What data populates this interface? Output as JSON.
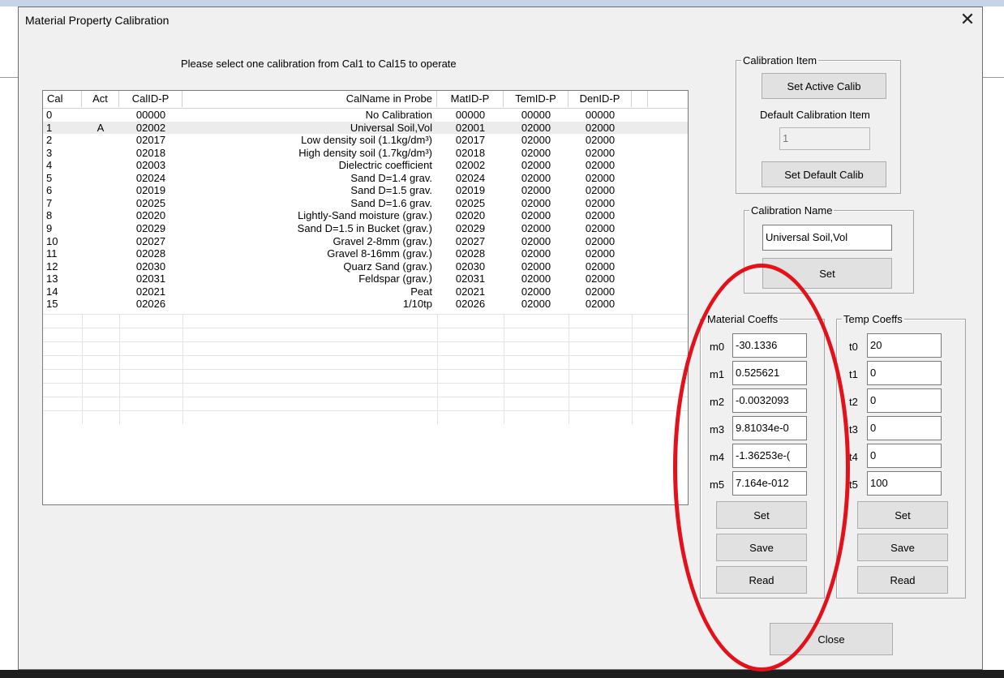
{
  "dialog": {
    "title": "Material Property Calibration",
    "close_glyph": "✕",
    "instruction": "Please select one calibration from Cal1 to Cal15 to operate"
  },
  "table": {
    "columns": [
      "Cal",
      "Act",
      "CalID-P",
      "CalName in Probe",
      "MatID-P",
      "TemID-P",
      "DenID-P"
    ],
    "rows": [
      {
        "cal": "0",
        "act": "",
        "calid": "00000",
        "name": "No Calibration",
        "matid": "00000",
        "temid": "00000",
        "denid": "00000"
      },
      {
        "cal": "1",
        "act": "A",
        "calid": "02002",
        "name": "Universal Soil,Vol",
        "matid": "02001",
        "temid": "02000",
        "denid": "02000"
      },
      {
        "cal": "2",
        "act": "",
        "calid": "02017",
        "name": "Low density soil (1.1kg/dm³)",
        "matid": "02017",
        "temid": "02000",
        "denid": "02000"
      },
      {
        "cal": "3",
        "act": "",
        "calid": "02018",
        "name": "High density soil (1.7kg/dm³)",
        "matid": "02018",
        "temid": "02000",
        "denid": "02000"
      },
      {
        "cal": "4",
        "act": "",
        "calid": "02003",
        "name": "Dielectric coefficient",
        "matid": "02002",
        "temid": "02000",
        "denid": "02000"
      },
      {
        "cal": "5",
        "act": "",
        "calid": "02024",
        "name": "Sand D=1.4 grav.",
        "matid": "02024",
        "temid": "02000",
        "denid": "02000"
      },
      {
        "cal": "6",
        "act": "",
        "calid": "02019",
        "name": "Sand D=1.5 grav.",
        "matid": "02019",
        "temid": "02000",
        "denid": "02000"
      },
      {
        "cal": "7",
        "act": "",
        "calid": "02025",
        "name": "Sand D=1.6 grav.",
        "matid": "02025",
        "temid": "02000",
        "denid": "02000"
      },
      {
        "cal": "8",
        "act": "",
        "calid": "02020",
        "name": "Lightly-Sand moisture (grav.)",
        "matid": "02020",
        "temid": "02000",
        "denid": "02000"
      },
      {
        "cal": "9",
        "act": "",
        "calid": "02029",
        "name": "Sand D=1.5 in Bucket (grav.)",
        "matid": "02029",
        "temid": "02000",
        "denid": "02000"
      },
      {
        "cal": "10",
        "act": "",
        "calid": "02027",
        "name": "Gravel 2-8mm (grav.)",
        "matid": "02027",
        "temid": "02000",
        "denid": "02000"
      },
      {
        "cal": "11",
        "act": "",
        "calid": "02028",
        "name": "Gravel 8-16mm (grav.)",
        "matid": "02028",
        "temid": "02000",
        "denid": "02000"
      },
      {
        "cal": "12",
        "act": "",
        "calid": "02030",
        "name": "Quarz Sand (grav.)",
        "matid": "02030",
        "temid": "02000",
        "denid": "02000"
      },
      {
        "cal": "13",
        "act": "",
        "calid": "02031",
        "name": "Feldspar (grav.)",
        "matid": "02031",
        "temid": "02000",
        "denid": "02000"
      },
      {
        "cal": "14",
        "act": "",
        "calid": "02021",
        "name": "Peat",
        "matid": "02021",
        "temid": "02000",
        "denid": "02000"
      },
      {
        "cal": "15",
        "act": "",
        "calid": "02026",
        "name": "1/10tp",
        "matid": "02026",
        "temid": "02000",
        "denid": "02000"
      }
    ]
  },
  "calibration_item": {
    "legend": "Calibration Item",
    "set_active_label": "Set Active Calib",
    "default_label": "Default Calibration Item",
    "default_value": "1",
    "set_default_label": "Set Default Calib"
  },
  "calibration_name": {
    "legend": "Calibration Name",
    "value": "Universal Soil,Vol",
    "set_label": "Set"
  },
  "material_coeffs": {
    "legend": "Material Coeffs",
    "items": [
      {
        "label": "m0",
        "value": "-30.1336"
      },
      {
        "label": "m1",
        "value": "0.525621"
      },
      {
        "label": "m2",
        "value": "-0.0032093"
      },
      {
        "label": "m3",
        "value": "9.81034e-0"
      },
      {
        "label": "m4",
        "value": "-1.36253e-("
      },
      {
        "label": "m5",
        "value": "7.164e-012"
      }
    ],
    "set_label": "Set",
    "save_label": "Save",
    "read_label": "Read"
  },
  "temp_coeffs": {
    "legend": "Temp Coeffs",
    "items": [
      {
        "label": "t0",
        "value": "20"
      },
      {
        "label": "t1",
        "value": "0"
      },
      {
        "label": "t2",
        "value": "0"
      },
      {
        "label": "t3",
        "value": "0"
      },
      {
        "label": "t4",
        "value": "0"
      },
      {
        "label": "t5",
        "value": "100"
      }
    ],
    "set_label": "Set",
    "save_label": "Save",
    "read_label": "Read"
  },
  "close_label": "Close",
  "annotation": {
    "color": "#e3111a"
  }
}
